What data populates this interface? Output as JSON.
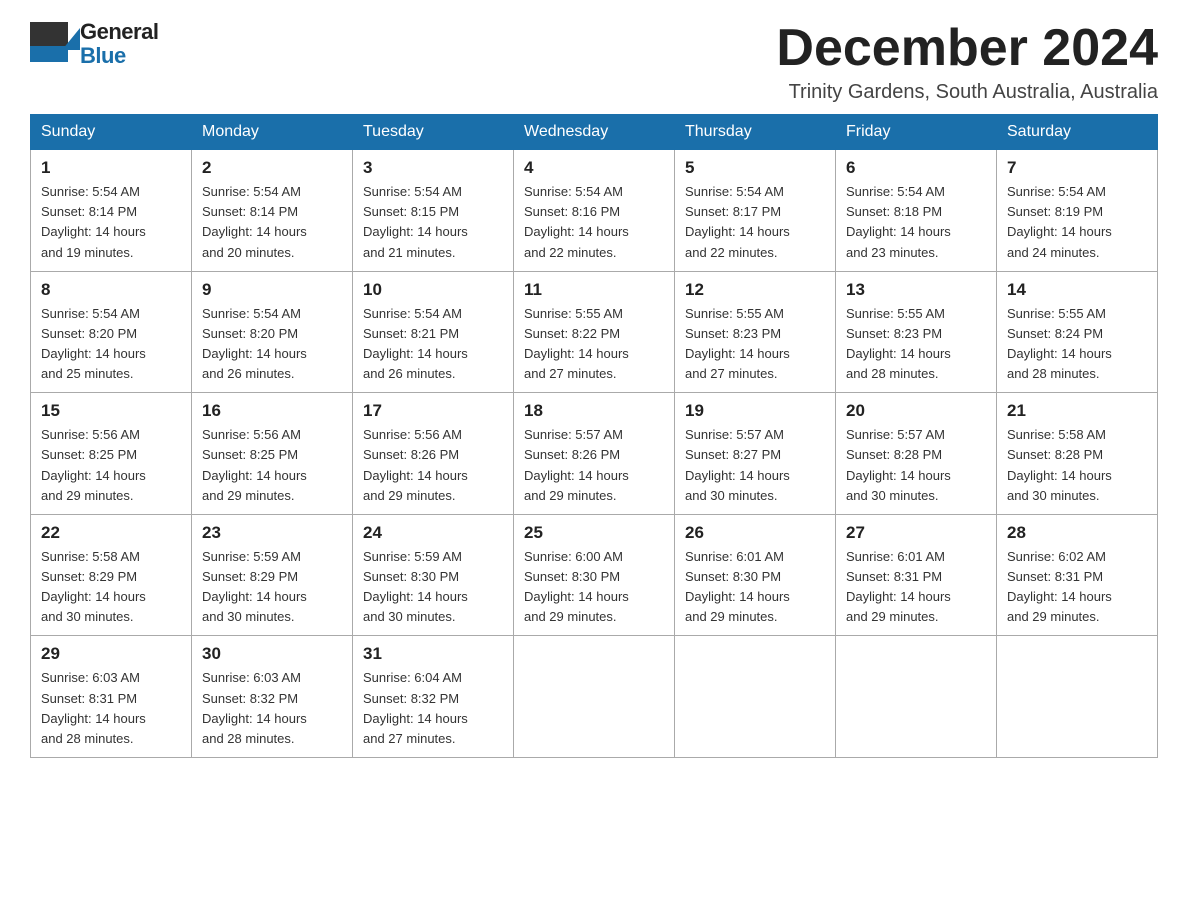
{
  "header": {
    "month_title": "December 2024",
    "location": "Trinity Gardens, South Australia, Australia",
    "logo_line1": "General",
    "logo_line2": "Blue"
  },
  "weekdays": [
    "Sunday",
    "Monday",
    "Tuesday",
    "Wednesday",
    "Thursday",
    "Friday",
    "Saturday"
  ],
  "weeks": [
    [
      {
        "day": "1",
        "sunrise": "5:54 AM",
        "sunset": "8:14 PM",
        "daylight": "14 hours and 19 minutes."
      },
      {
        "day": "2",
        "sunrise": "5:54 AM",
        "sunset": "8:14 PM",
        "daylight": "14 hours and 20 minutes."
      },
      {
        "day": "3",
        "sunrise": "5:54 AM",
        "sunset": "8:15 PM",
        "daylight": "14 hours and 21 minutes."
      },
      {
        "day": "4",
        "sunrise": "5:54 AM",
        "sunset": "8:16 PM",
        "daylight": "14 hours and 22 minutes."
      },
      {
        "day": "5",
        "sunrise": "5:54 AM",
        "sunset": "8:17 PM",
        "daylight": "14 hours and 22 minutes."
      },
      {
        "day": "6",
        "sunrise": "5:54 AM",
        "sunset": "8:18 PM",
        "daylight": "14 hours and 23 minutes."
      },
      {
        "day": "7",
        "sunrise": "5:54 AM",
        "sunset": "8:19 PM",
        "daylight": "14 hours and 24 minutes."
      }
    ],
    [
      {
        "day": "8",
        "sunrise": "5:54 AM",
        "sunset": "8:20 PM",
        "daylight": "14 hours and 25 minutes."
      },
      {
        "day": "9",
        "sunrise": "5:54 AM",
        "sunset": "8:20 PM",
        "daylight": "14 hours and 26 minutes."
      },
      {
        "day": "10",
        "sunrise": "5:54 AM",
        "sunset": "8:21 PM",
        "daylight": "14 hours and 26 minutes."
      },
      {
        "day": "11",
        "sunrise": "5:55 AM",
        "sunset": "8:22 PM",
        "daylight": "14 hours and 27 minutes."
      },
      {
        "day": "12",
        "sunrise": "5:55 AM",
        "sunset": "8:23 PM",
        "daylight": "14 hours and 27 minutes."
      },
      {
        "day": "13",
        "sunrise": "5:55 AM",
        "sunset": "8:23 PM",
        "daylight": "14 hours and 28 minutes."
      },
      {
        "day": "14",
        "sunrise": "5:55 AM",
        "sunset": "8:24 PM",
        "daylight": "14 hours and 28 minutes."
      }
    ],
    [
      {
        "day": "15",
        "sunrise": "5:56 AM",
        "sunset": "8:25 PM",
        "daylight": "14 hours and 29 minutes."
      },
      {
        "day": "16",
        "sunrise": "5:56 AM",
        "sunset": "8:25 PM",
        "daylight": "14 hours and 29 minutes."
      },
      {
        "day": "17",
        "sunrise": "5:56 AM",
        "sunset": "8:26 PM",
        "daylight": "14 hours and 29 minutes."
      },
      {
        "day": "18",
        "sunrise": "5:57 AM",
        "sunset": "8:26 PM",
        "daylight": "14 hours and 29 minutes."
      },
      {
        "day": "19",
        "sunrise": "5:57 AM",
        "sunset": "8:27 PM",
        "daylight": "14 hours and 30 minutes."
      },
      {
        "day": "20",
        "sunrise": "5:57 AM",
        "sunset": "8:28 PM",
        "daylight": "14 hours and 30 minutes."
      },
      {
        "day": "21",
        "sunrise": "5:58 AM",
        "sunset": "8:28 PM",
        "daylight": "14 hours and 30 minutes."
      }
    ],
    [
      {
        "day": "22",
        "sunrise": "5:58 AM",
        "sunset": "8:29 PM",
        "daylight": "14 hours and 30 minutes."
      },
      {
        "day": "23",
        "sunrise": "5:59 AM",
        "sunset": "8:29 PM",
        "daylight": "14 hours and 30 minutes."
      },
      {
        "day": "24",
        "sunrise": "5:59 AM",
        "sunset": "8:30 PM",
        "daylight": "14 hours and 30 minutes."
      },
      {
        "day": "25",
        "sunrise": "6:00 AM",
        "sunset": "8:30 PM",
        "daylight": "14 hours and 29 minutes."
      },
      {
        "day": "26",
        "sunrise": "6:01 AM",
        "sunset": "8:30 PM",
        "daylight": "14 hours and 29 minutes."
      },
      {
        "day": "27",
        "sunrise": "6:01 AM",
        "sunset": "8:31 PM",
        "daylight": "14 hours and 29 minutes."
      },
      {
        "day": "28",
        "sunrise": "6:02 AM",
        "sunset": "8:31 PM",
        "daylight": "14 hours and 29 minutes."
      }
    ],
    [
      {
        "day": "29",
        "sunrise": "6:03 AM",
        "sunset": "8:31 PM",
        "daylight": "14 hours and 28 minutes."
      },
      {
        "day": "30",
        "sunrise": "6:03 AM",
        "sunset": "8:32 PM",
        "daylight": "14 hours and 28 minutes."
      },
      {
        "day": "31",
        "sunrise": "6:04 AM",
        "sunset": "8:32 PM",
        "daylight": "14 hours and 27 minutes."
      },
      null,
      null,
      null,
      null
    ]
  ],
  "labels": {
    "sunrise": "Sunrise:",
    "sunset": "Sunset:",
    "daylight": "Daylight:"
  }
}
